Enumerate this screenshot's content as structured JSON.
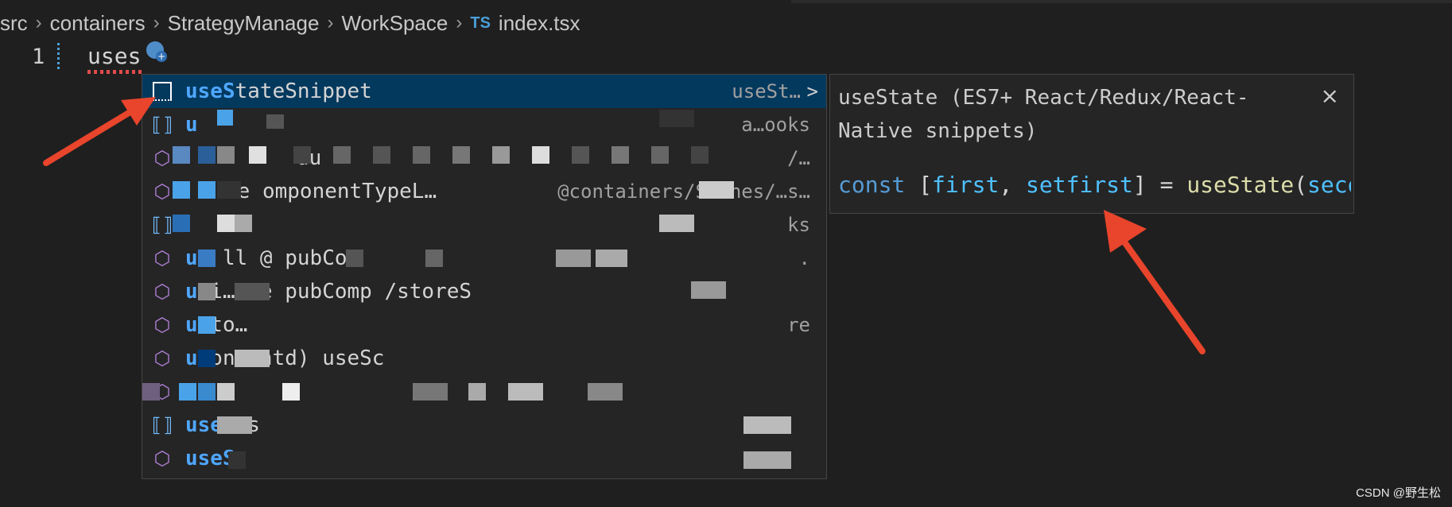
{
  "breadcrumb": {
    "items": [
      "src",
      "containers",
      "StrategyManage",
      "WorkSpace"
    ],
    "file_badge": "TS",
    "file_name": "index.tsx"
  },
  "editor": {
    "line_number": "1",
    "typed_text": "uses"
  },
  "suggest": {
    "selected": {
      "match": "useS",
      "rest": "tateSnippet",
      "detail": "useSt…",
      "chevron": ">"
    },
    "rows": [
      {
        "icon": "variable-icon",
        "match": "u",
        "rest": "",
        "detail": "a…ooks"
      },
      {
        "icon": "module-icon",
        "match": "",
        "rest": "du",
        "detail": "/…"
      },
      {
        "icon": "module-icon",
        "match": "",
        "rest": "re  omponentTypeL…",
        "detail": "@containers/Scenes/…s…"
      },
      {
        "icon": "variable-icon",
        "match": "",
        "rest": "",
        "detail": "ks"
      },
      {
        "icon": "module-icon",
        "match": "us",
        "rest": "  ll  @      pubCom",
        "detail": "."
      },
      {
        "icon": "module-icon",
        "match": "u",
        "rest": "   i…     ne   pubComp    /storeS",
        "detail": ""
      },
      {
        "icon": "module-icon",
        "match": "u",
        "rest": "   to…",
        "detail": "re"
      },
      {
        "icon": "module-icon",
        "match": "u",
        "rest": "   on       antd)       useSc",
        "detail": ""
      },
      {
        "icon": "module-icon",
        "match": "",
        "rest": "",
        "detail": ""
      },
      {
        "icon": "variable-icon",
        "match": "use",
        "rest": "     ns",
        "detail": ""
      },
      {
        "icon": "module-icon",
        "match": "useS",
        "rest": "",
        "detail": ""
      }
    ]
  },
  "details": {
    "title": "useState (ES7+ React/Redux/React-Native snippets)",
    "close": "×",
    "code": {
      "kw": "const",
      "open": " [",
      "v1": "first",
      "comma": ", ",
      "v2": "setfirst",
      "mid": "] = ",
      "fn": "useState",
      "paren": "(",
      "v3": "seco"
    }
  },
  "watermark": "CSDN @野生松",
  "colors": {
    "background": "#1f1f1f",
    "panel": "#252526",
    "selected_row": "#04395e",
    "match_highlight": "#4fa7ff",
    "arrow": "#e8452c"
  }
}
